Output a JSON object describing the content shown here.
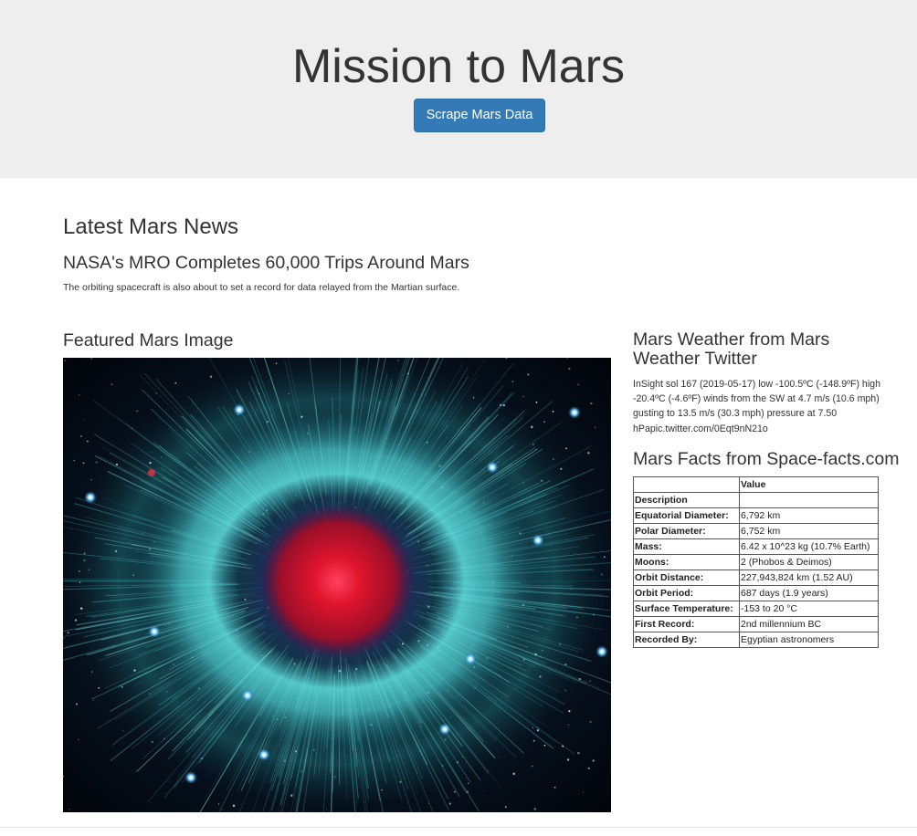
{
  "header": {
    "title": "Mission to Mars",
    "scrape_button_label": "Scrape Mars Data"
  },
  "news": {
    "heading": "Latest Mars News",
    "title": "NASA's MRO Completes 60,000 Trips Around Mars",
    "teaser": "The orbiting spacecraft is also about to set a record for data relayed from the Martian surface."
  },
  "featured": {
    "heading": "Featured Mars Image"
  },
  "weather": {
    "heading": "Mars Weather from Mars Weather Twitter",
    "text": "InSight sol 167 (2019-05-17) low -100.5ºC (-148.9ºF) high -20.4ºC (-4.6ºF) winds from the SW at 4.7 m/s (10.6 mph) gusting to 13.5 m/s (30.3 mph) pressure at 7.50 hPapic.twitter.com/0Eqt9nN21o"
  },
  "facts": {
    "heading": "Mars Facts from Space-facts.com",
    "header_label": "",
    "header_value": "Value",
    "index_name": "Description",
    "rows": [
      {
        "label": "Equatorial Diameter:",
        "value": "6,792 km"
      },
      {
        "label": "Polar Diameter:",
        "value": "6,752 km"
      },
      {
        "label": "Mass:",
        "value": "6.42 x 10^23 kg (10.7% Earth)"
      },
      {
        "label": "Moons:",
        "value": "2 (Phobos & Deimos)"
      },
      {
        "label": "Orbit Distance:",
        "value": "227,943,824 km (1.52 AU)"
      },
      {
        "label": "Orbit Period:",
        "value": "687 days (1.9 years)"
      },
      {
        "label": "Surface Temperature:",
        "value": "-153 to 20 °C"
      },
      {
        "label": "First Record:",
        "value": "2nd millennium BC"
      },
      {
        "label": "Recorded By:",
        "value": "Egyptian astronomers"
      }
    ]
  },
  "colors": {
    "jumbotron_bg": "#eeeeee",
    "button_primary": "#337ab7",
    "nebula_cyan": "#4fd3d6",
    "nebula_core": "#e0142c"
  }
}
